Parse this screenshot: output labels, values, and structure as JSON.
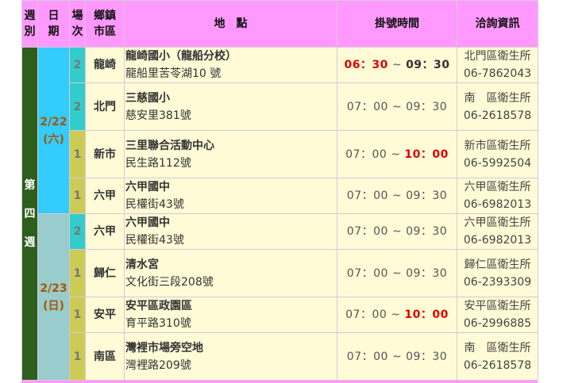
{
  "headers": {
    "week": [
      "週",
      "別"
    ],
    "date": [
      "日",
      "期"
    ],
    "session": [
      "場",
      "次"
    ],
    "town": [
      "鄉鎮",
      "市區"
    ],
    "place": "地　點",
    "time": "掛號時間",
    "info": "洽詢資訊"
  },
  "week_label": [
    "第",
    "四",
    "週"
  ],
  "dates": [
    {
      "date": "2/22",
      "day": "(六)"
    },
    {
      "date": "2/23",
      "day": "(日)"
    }
  ],
  "rows": [
    {
      "session": "2",
      "town": "龍崎",
      "name": "龍崎國小（龍船分校）",
      "address": "龍船里苦苓湖10 號",
      "time_start": "06：30",
      "time_sep": " ~ ",
      "time_end": "09：30",
      "info_org": "北門區衛生所",
      "info_phone": "06-7862043"
    },
    {
      "session": "2",
      "town": "北門",
      "name": "三慈國小",
      "address": "慈安里381號",
      "time_start": "07：00",
      "time_sep": " ~ ",
      "time_end": "09：30",
      "info_org": "南　區衛生所",
      "info_phone": "06-2618578"
    },
    {
      "session": "1",
      "town": "新市",
      "name": "三里聯合活動中心",
      "address": "民生路112號",
      "time_start": "07：00",
      "time_sep": " ~ ",
      "time_end": "10：00",
      "info_org": "新市區衛生所",
      "info_phone": "06-5992504"
    },
    {
      "session": "1",
      "town": "六甲",
      "name": "六甲國中",
      "address": "民權街43號",
      "time_start": "07：00",
      "time_sep": " ~ ",
      "time_end": "09：30",
      "info_org": "六甲區衛生所",
      "info_phone": "06-6982013"
    },
    {
      "session": "2",
      "town": "六甲",
      "name": "六甲國中",
      "address": "民權街43號",
      "time_start": "07：00",
      "time_sep": " ~ ",
      "time_end": "09：30",
      "info_org": "六甲區衛生所",
      "info_phone": "06-6982013"
    },
    {
      "session": "1",
      "town": "歸仁",
      "name": "清水宮",
      "address": "文化街三段208號",
      "time_start": "07：00",
      "time_sep": " ~ ",
      "time_end": "09：30",
      "info_org": "歸仁區衛生所",
      "info_phone": "06-2393309"
    },
    {
      "session": "1",
      "town": "安平",
      "name": "安平區政園區",
      "address": "育平路310號",
      "time_start": "07：00",
      "time_sep": " ~ ",
      "time_end": "10：00",
      "info_org": "安平區衛生所",
      "info_phone": "06-2996885"
    },
    {
      "session": "1",
      "town": "南區",
      "name": "灣裡市場旁空地",
      "address": "灣裡路209號",
      "time_start": "07：00",
      "time_sep": " ~ ",
      "time_end": "09：30",
      "info_org": "南　區衛生所",
      "info_phone": "06-2618578"
    }
  ]
}
